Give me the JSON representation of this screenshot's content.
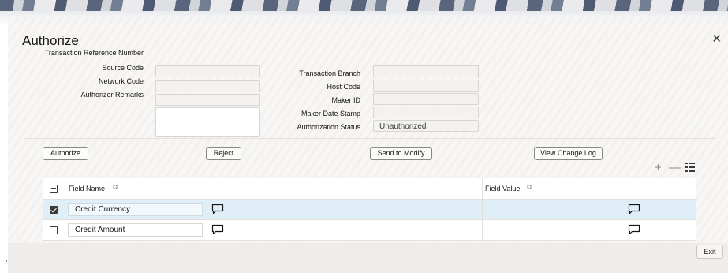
{
  "dialog": {
    "title": "Authorize",
    "close_icon": "close-icon"
  },
  "form": {
    "left": [
      {
        "label": "Transaction Reference Number",
        "value": ""
      },
      {
        "label": "Source Code",
        "value": ""
      },
      {
        "label": "Network Code",
        "value": ""
      },
      {
        "label": "Authorizer Remarks",
        "value": ""
      }
    ],
    "right": [
      {
        "label": "Transaction Branch",
        "value": ""
      },
      {
        "label": "Host Code",
        "value": ""
      },
      {
        "label": "Maker ID",
        "value": ""
      },
      {
        "label": "Maker Date Stamp",
        "value": ""
      },
      {
        "label": "Authorization Status",
        "value": "Unauthorized"
      }
    ]
  },
  "actions": {
    "authorize": "Authorize",
    "reject": "Reject",
    "send_to_modify": "Send to Modify",
    "view_change_log": "View Change Log"
  },
  "table": {
    "headers": {
      "field_name": "Field Name",
      "field_value": "Field Value"
    },
    "sort_glyph": "≎",
    "rows": [
      {
        "checked": true,
        "field_name": "Credit Currency",
        "field_value": ""
      },
      {
        "checked": false,
        "field_name": "Credit Amount",
        "field_value": ""
      }
    ]
  },
  "toolbar": {
    "add_icon": "plus-icon",
    "remove_icon": "minus-icon",
    "columns_icon": "column-list-icon"
  },
  "footer": {
    "exit": "Exit"
  }
}
